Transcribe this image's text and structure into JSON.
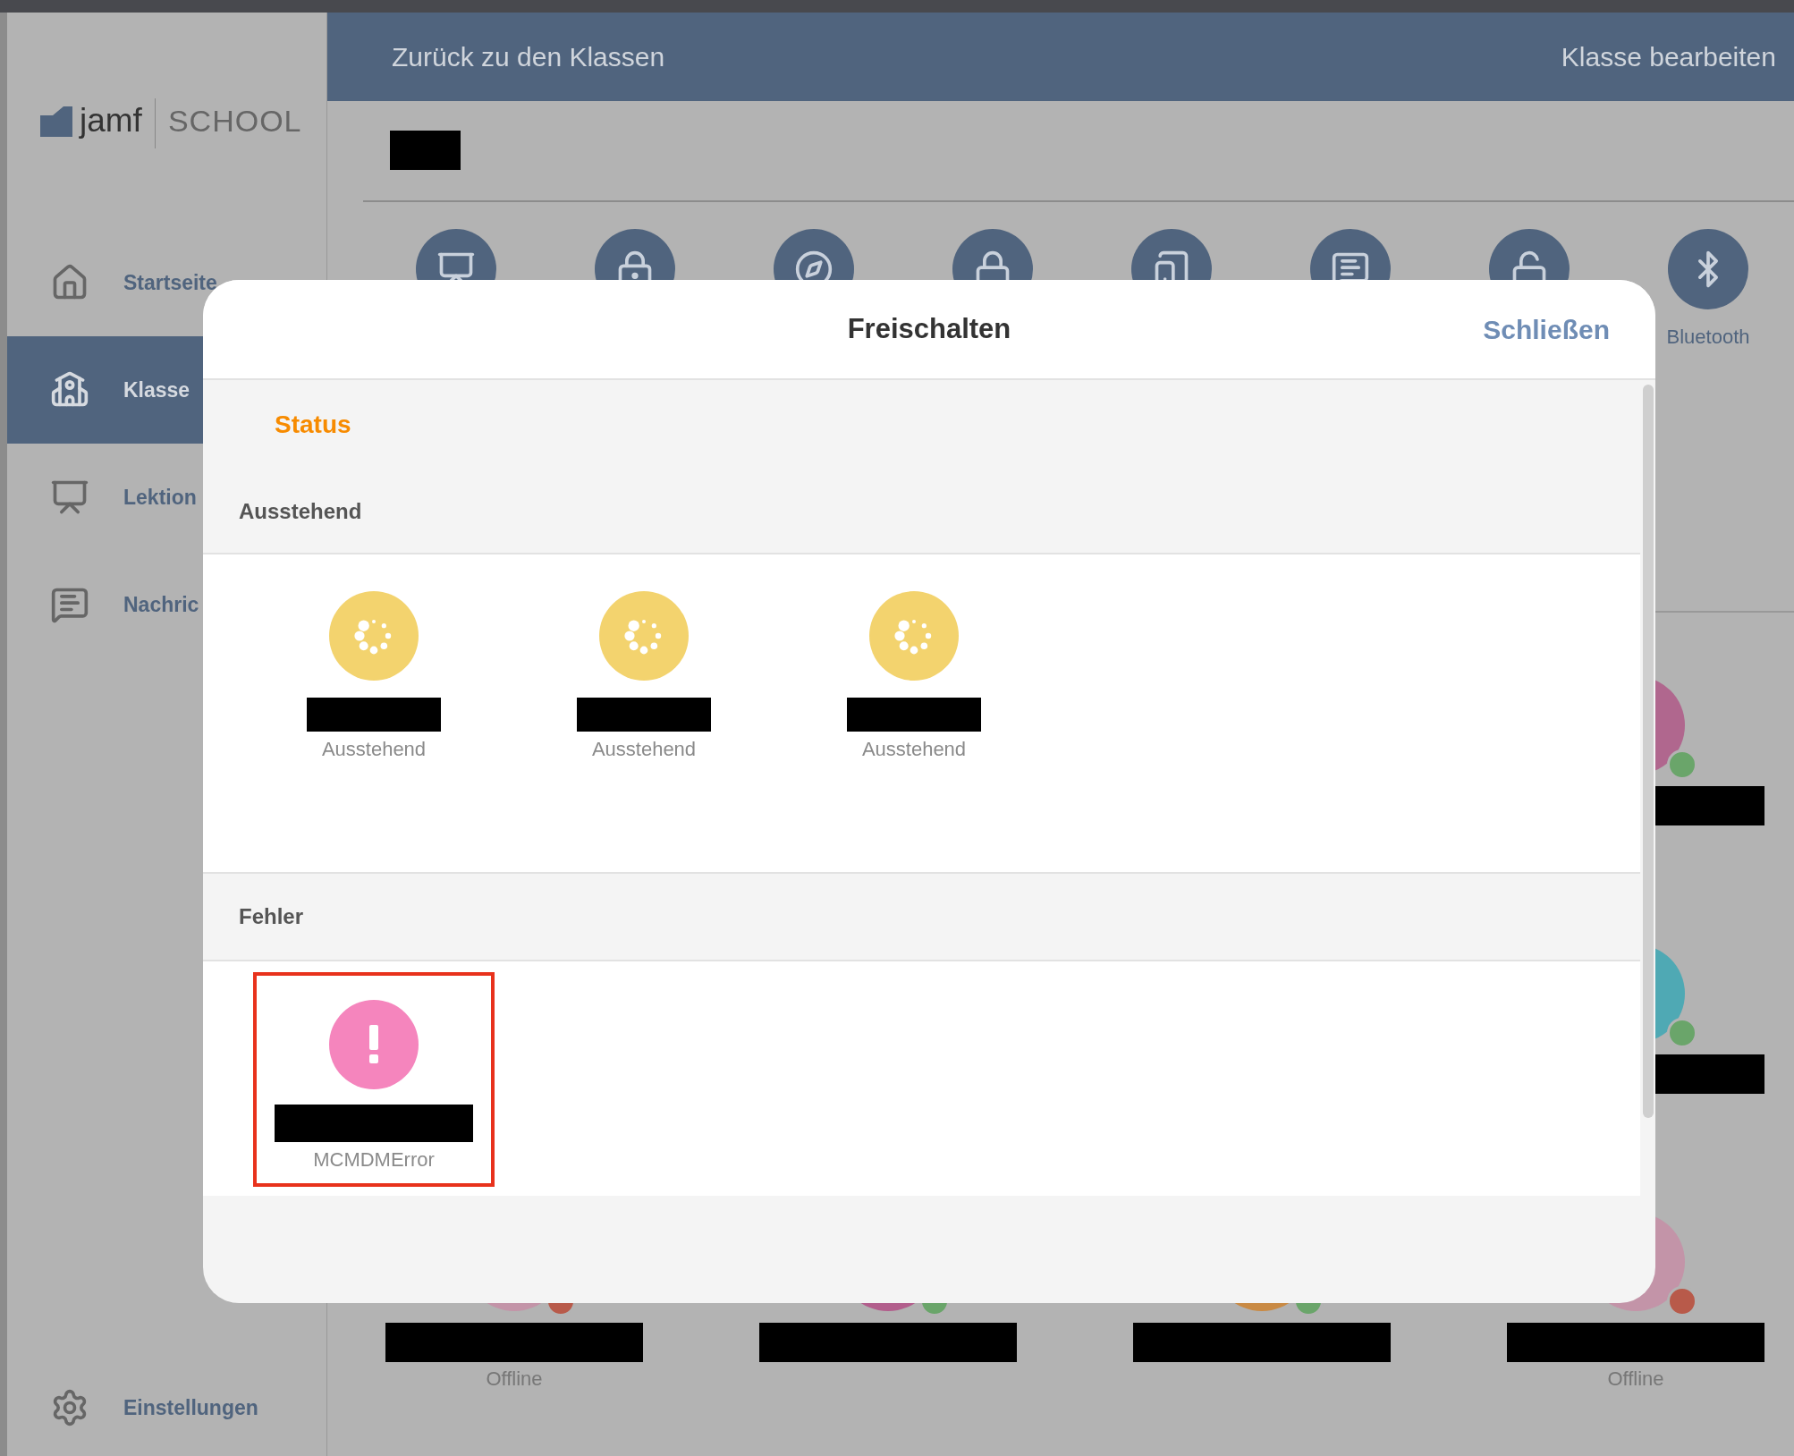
{
  "logo": {
    "brand": "jamf",
    "product": "SCHOOL"
  },
  "sidebar": {
    "items": [
      {
        "kind": "home",
        "label": "Startseite",
        "selected": false
      },
      {
        "kind": "classes",
        "label": "Klasse",
        "selected": true
      },
      {
        "kind": "lessons",
        "label": "Lektion",
        "selected": false
      },
      {
        "kind": "messages",
        "label": "Nachric",
        "selected": false
      }
    ],
    "settings": {
      "kind": "settings",
      "label": "Einstellungen"
    }
  },
  "header": {
    "back": "Zurück zu den Klassen",
    "edit": "Klasse bearbeiten"
  },
  "actions": [
    {
      "kind": "lesson"
    },
    {
      "kind": "app-lock"
    },
    {
      "kind": "web"
    },
    {
      "kind": "lock"
    },
    {
      "kind": "device-alert"
    },
    {
      "kind": "message"
    },
    {
      "kind": "unlock"
    },
    {
      "kind": "bluetooth",
      "label": "Bluetooth"
    }
  ],
  "student_rows": [
    {
      "students": [
        {
          "color": "#b0678e",
          "online": true
        }
      ]
    },
    {
      "students": [
        {
          "color": "#4fa9b4",
          "online": true
        }
      ]
    },
    {
      "students": [
        {
          "color": "#c394a8",
          "online": false,
          "status": "Offline"
        },
        {
          "color": "#b25e8c",
          "online": true
        },
        {
          "color": "#c98a44",
          "online": true
        },
        {
          "color": "#c394a8",
          "online": false,
          "status": "Offline"
        }
      ]
    }
  ],
  "modal": {
    "title": "Freischalten",
    "close": "Schließen",
    "status_tab": "Status",
    "sections": [
      {
        "title": "Ausstehend",
        "items": [
          {
            "kind": "pending",
            "status": "Ausstehend",
            "highlighted": false
          },
          {
            "kind": "pending",
            "status": "Ausstehend",
            "highlighted": false
          },
          {
            "kind": "pending",
            "status": "Ausstehend",
            "highlighted": false
          }
        ]
      },
      {
        "title": "Fehler",
        "items": [
          {
            "kind": "error",
            "status": "MCMDMError",
            "highlighted": true
          }
        ]
      }
    ]
  }
}
